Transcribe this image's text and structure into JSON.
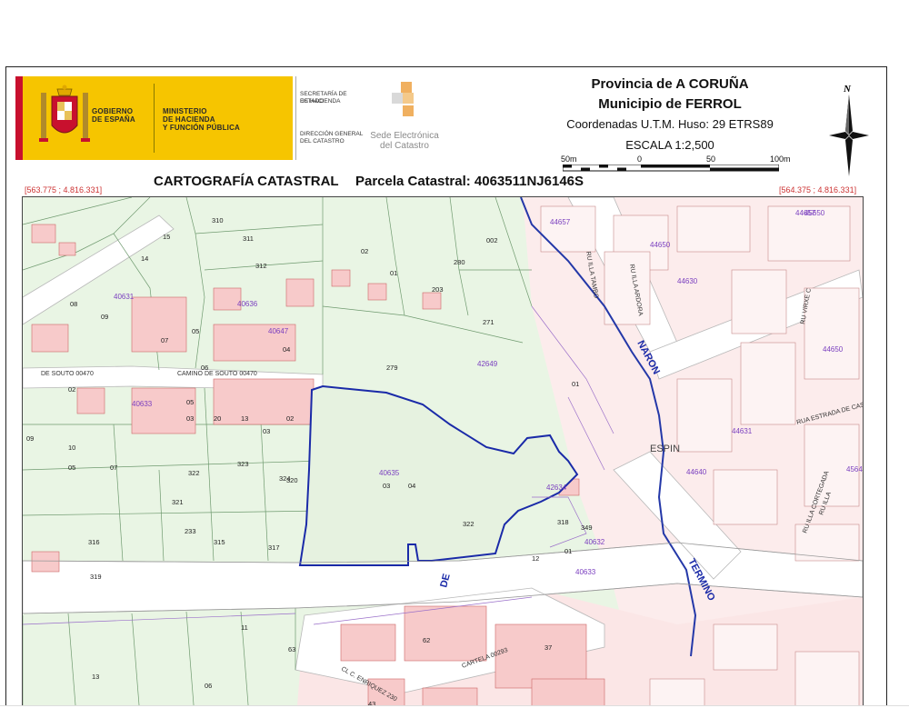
{
  "header": {
    "gov_line1": "GOBIERNO",
    "gov_line2": "DE ESPAÑA",
    "min_line1": "MINISTERIO",
    "min_line2": "DE HACIENDA",
    "min_line3": "Y FUNCIÓN PÚBLICA",
    "sec_line1": "SECRETARÍA DE ESTADO",
    "sec_line2": "DE HACIENDA",
    "dir_line1": "DIRECCIÓN GENERAL",
    "dir_line2": "DEL CATASTRO",
    "sede_line1": "Sede Electrónica",
    "sede_line2": "del Catastro",
    "provincia": "Provincia de A CORUÑA",
    "municipio": "Municipio de FERROL",
    "coordenadas": "Coordenadas U.T.M. Huso: 29 ETRS89",
    "escala": "ESCALA 1:2,500",
    "scale_labels": [
      "50m",
      "0",
      "50",
      "100m"
    ],
    "north_label": "N",
    "cartografia": "CARTOGRAFÍA CATASTRAL",
    "parcela": "Parcela Catastral: 4063511NJ6146S",
    "corner_left": "[563.775 ; 4.816.331]",
    "corner_right": "[564.375 ; 4.816.331]"
  },
  "colors": {
    "gov_yellow": "#f6c500",
    "gov_red": "#c8102e",
    "rural_fill": "#e9f5e4",
    "urban_fill": "#fbe3e3",
    "parcel_highlight": "#1a2aa8",
    "boundary_blue": "#2438a8",
    "label_purple": "#7a3fbf"
  },
  "map": {
    "purple_labels": [
      "40631",
      "40636",
      "40647",
      "42649",
      "40633",
      "40635",
      "42634",
      "40632",
      "40633",
      "44657",
      "44650",
      "44630",
      "44631",
      "44640",
      "44650",
      "44657",
      "45650",
      "4564"
    ],
    "black_labels": [
      "310",
      "311",
      "312",
      "15",
      "14",
      "09",
      "08",
      "05",
      "06",
      "04",
      "07",
      "02",
      "01",
      "203",
      "002",
      "280",
      "271",
      "279",
      "01",
      "05",
      "02",
      "03",
      "20",
      "13",
      "02",
      "03",
      "05",
      "09",
      "10",
      "07",
      "322",
      "323",
      "324",
      "321",
      "320",
      "233",
      "316",
      "315",
      "319",
      "317",
      "322",
      "318",
      "349",
      "12",
      "03",
      "04",
      "01",
      "11",
      "13",
      "06",
      "63",
      "43",
      "62",
      "12",
      "37",
      "03",
      "04"
    ],
    "street_labels": [
      "DE SOUTO 00470",
      "CAMINO DE SOUTO 00470",
      "DE",
      "CL C. ENRIQUEZ 230",
      "CARTELA 00293",
      "RU ILLA TAMBO",
      "RU ILLA ARDORA",
      "RU VIRXE C",
      "RUA ESTRADA DE CAST",
      "RU ILLA CORTEGADA",
      "RU ILLA",
      "ESPIN"
    ],
    "boundary_labels": [
      "NARON",
      "TERMINO"
    ]
  }
}
